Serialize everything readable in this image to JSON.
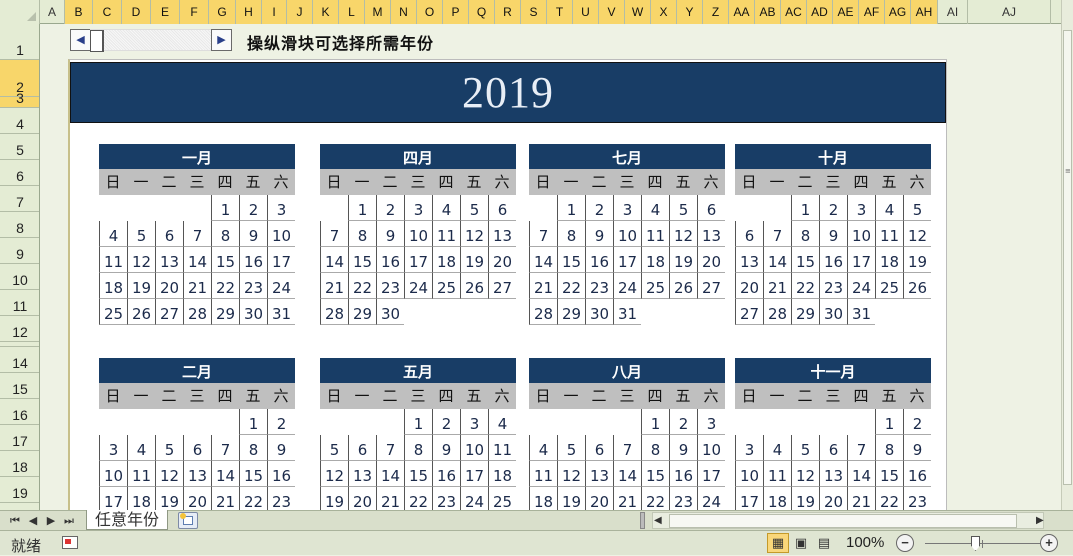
{
  "column_headers": [
    "A",
    "B",
    "C",
    "D",
    "E",
    "F",
    "G",
    "H",
    "I",
    "J",
    "K",
    "L",
    "M",
    "N",
    "O",
    "P",
    "Q",
    "R",
    "S",
    "T",
    "U",
    "V",
    "W",
    "X",
    "Y",
    "Z",
    "AA",
    "AB",
    "AC",
    "AD",
    "AE",
    "AF",
    "AG",
    "AH",
    "AI",
    "AJ"
  ],
  "selected_columns_from": "B",
  "selected_columns_to": "AH",
  "row_headers": [
    "1",
    "2",
    "3",
    "4",
    "5",
    "6",
    "7",
    "8",
    "9",
    "10",
    "11",
    "12",
    "",
    "14",
    "15",
    "16",
    "17",
    "18",
    "19"
  ],
  "selected_rows": [
    "2",
    "3"
  ],
  "scroll_control": {
    "left_arrow": "◀",
    "right_arrow": "▶"
  },
  "hint_label": "操纵滑块可选择所需年份",
  "year": "2019",
  "weekdays": [
    "日",
    "一",
    "二",
    "三",
    "四",
    "五",
    "六"
  ],
  "months": [
    {
      "name": "一月",
      "days": [
        [
          null,
          null,
          null,
          null,
          "1",
          "2",
          "3"
        ],
        [
          "4",
          "5",
          "6",
          "7",
          "8",
          "9",
          "10"
        ],
        [
          "11",
          "12",
          "13",
          "14",
          "15",
          "16",
          "17"
        ],
        [
          "18",
          "19",
          "20",
          "21",
          "22",
          "23",
          "24"
        ],
        [
          "25",
          "26",
          "27",
          "28",
          "29",
          "30",
          "31"
        ]
      ]
    },
    {
      "name": "四月",
      "days": [
        [
          null,
          "1",
          "2",
          "3",
          "4",
          "5",
          "6"
        ],
        [
          "7",
          "8",
          "9",
          "10",
          "11",
          "12",
          "13"
        ],
        [
          "14",
          "15",
          "16",
          "17",
          "18",
          "19",
          "20"
        ],
        [
          "21",
          "22",
          "23",
          "24",
          "25",
          "26",
          "27"
        ],
        [
          "28",
          "29",
          "30",
          null,
          null,
          null,
          null
        ]
      ]
    },
    {
      "name": "七月",
      "days": [
        [
          null,
          "1",
          "2",
          "3",
          "4",
          "5",
          "6"
        ],
        [
          "7",
          "8",
          "9",
          "10",
          "11",
          "12",
          "13"
        ],
        [
          "14",
          "15",
          "16",
          "17",
          "18",
          "19",
          "20"
        ],
        [
          "21",
          "22",
          "23",
          "24",
          "25",
          "26",
          "27"
        ],
        [
          "28",
          "29",
          "30",
          "31",
          null,
          null,
          null
        ]
      ]
    },
    {
      "name": "十月",
      "days": [
        [
          null,
          null,
          "1",
          "2",
          "3",
          "4",
          "5"
        ],
        [
          "6",
          "7",
          "8",
          "9",
          "10",
          "11",
          "12"
        ],
        [
          "13",
          "14",
          "15",
          "16",
          "17",
          "18",
          "19"
        ],
        [
          "20",
          "21",
          "22",
          "23",
          "24",
          "25",
          "26"
        ],
        [
          "27",
          "28",
          "29",
          "30",
          "31",
          null,
          null
        ]
      ]
    },
    {
      "name": "二月",
      "days": [
        [
          null,
          null,
          null,
          null,
          null,
          "1",
          "2"
        ],
        [
          "3",
          "4",
          "5",
          "6",
          "7",
          "8",
          "9"
        ],
        [
          "10",
          "11",
          "12",
          "13",
          "14",
          "15",
          "16"
        ],
        [
          "17",
          "18",
          "19",
          "20",
          "21",
          "22",
          "23"
        ]
      ]
    },
    {
      "name": "五月",
      "days": [
        [
          null,
          null,
          null,
          "1",
          "2",
          "3",
          "4"
        ],
        [
          "5",
          "6",
          "7",
          "8",
          "9",
          "10",
          "11"
        ],
        [
          "12",
          "13",
          "14",
          "15",
          "16",
          "17",
          "18"
        ],
        [
          "19",
          "20",
          "21",
          "22",
          "23",
          "24",
          "25"
        ]
      ]
    },
    {
      "name": "八月",
      "days": [
        [
          null,
          null,
          null,
          null,
          "1",
          "2",
          "3"
        ],
        [
          "4",
          "5",
          "6",
          "7",
          "8",
          "9",
          "10"
        ],
        [
          "11",
          "12",
          "13",
          "14",
          "15",
          "16",
          "17"
        ],
        [
          "18",
          "19",
          "20",
          "21",
          "22",
          "23",
          "24"
        ]
      ]
    },
    {
      "name": "十一月",
      "days": [
        [
          null,
          null,
          null,
          null,
          null,
          "1",
          "2"
        ],
        [
          "3",
          "4",
          "5",
          "6",
          "7",
          "8",
          "9"
        ],
        [
          "10",
          "11",
          "12",
          "13",
          "14",
          "15",
          "16"
        ],
        [
          "17",
          "18",
          "19",
          "20",
          "21",
          "22",
          "23"
        ]
      ]
    }
  ],
  "sheet_tab": "任意年份",
  "status_text": "就绪",
  "zoom_level": "100%",
  "zoom_fraction": 0.5,
  "colors": {
    "accent_navy": "#183d66",
    "weekday_gray": "#bfbfbf",
    "selection_yellow": "#f8d66a"
  }
}
